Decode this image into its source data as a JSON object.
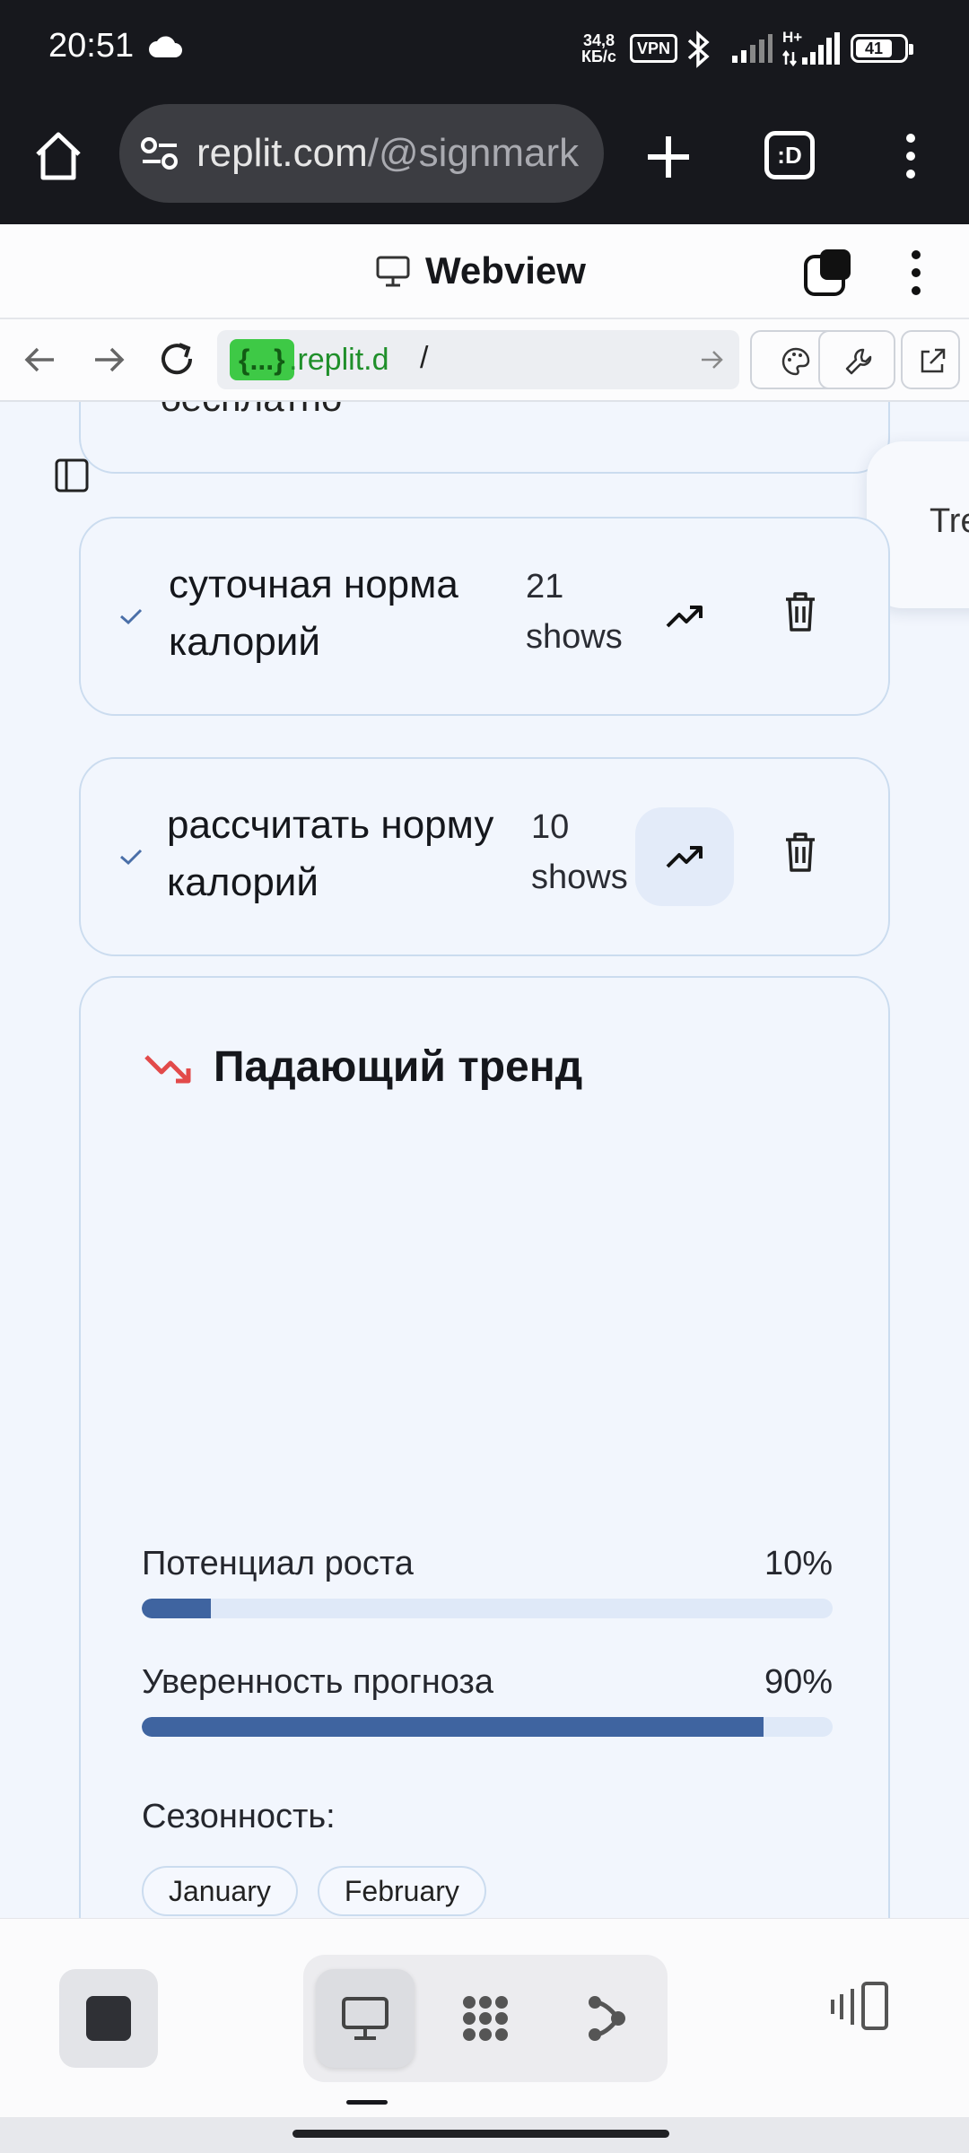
{
  "status_bar": {
    "time": "20:51",
    "net_speed_value": "34,8",
    "net_speed_unit": "КБ/с",
    "vpn": "VPN",
    "signal2_label": "H+",
    "battery": "41",
    "icons": [
      "cloud-icon",
      "bluetooth-icon",
      "signal-icon",
      "battery-icon"
    ]
  },
  "browser": {
    "url_host": "replit.com",
    "url_rest": "/@signmark",
    "tabs_label": ":D"
  },
  "webview": {
    "title": "Webview",
    "address_tag": "{...}",
    "address_host": ".replit.d",
    "address_path": "/"
  },
  "content": {
    "partial_card_text": "бесплатно",
    "side_popup_text": "Tre",
    "keywords": [
      {
        "text": "суточная норма калорий",
        "shows": "21 shows",
        "active": false
      },
      {
        "text": "рассчитать норму калорий",
        "shows": "10 shows",
        "active": true
      }
    ],
    "trend": {
      "title": "Падающий тренд",
      "trend_color": "#e24a4a",
      "metrics": [
        {
          "label": "Потенциал роста",
          "value": "10%",
          "fraction": 0.1
        },
        {
          "label": "Уверенность прогноза",
          "value": "90%",
          "fraction": 0.9
        }
      ],
      "seasonality_label": "Сезонность:",
      "months": [
        "January",
        "February"
      ]
    }
  },
  "bottom_bar": {
    "tabs": [
      "monitor-icon",
      "modules-icon",
      "share-icon"
    ],
    "active_tab": 0
  },
  "colors": {
    "accent_bar": "#3f64a0",
    "card_border": "#cbdcef",
    "page_bg": "#f2f6fd"
  }
}
